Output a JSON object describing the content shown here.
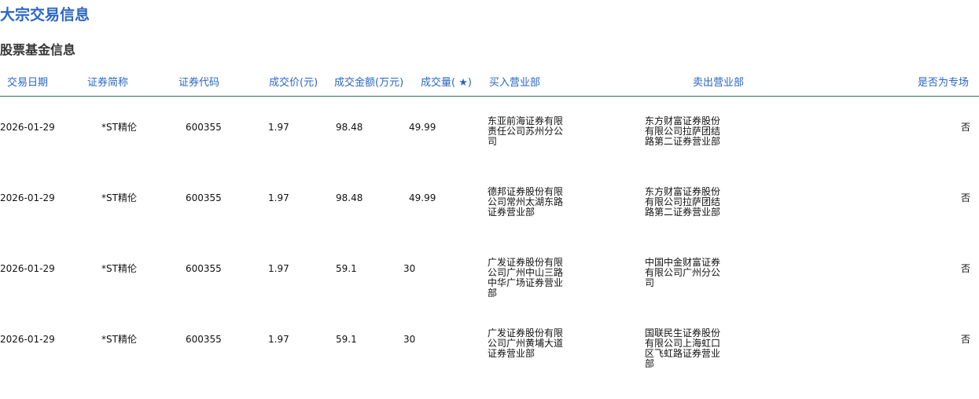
{
  "page": {
    "title": "大宗交易信息",
    "section_title": "股票基金信息"
  },
  "table": {
    "headers": [
      "交易日期",
      "证券简称",
      "证券代码",
      "成交价(元)",
      "成交金额(万元)",
      "成交量( ★)",
      "买入营业部",
      "卖出营业部",
      "是否为专场"
    ],
    "rows": [
      [
        "2026-01-29",
        "*ST精伦",
        "600355",
        "1.97",
        "98.48",
        "49.99",
        "东亚前海证券有限责任公司苏州分公司",
        "东方财富证券股份有限公司拉萨团结路第二证券营业部",
        "否"
      ],
      [
        "2026-01-29",
        "*ST精伦",
        "600355",
        "1.97",
        "98.48",
        "49.99",
        "德邦证券股份有限公司常州太湖东路证券营业部",
        "东方财富证券股份有限公司拉萨团结路第二证券营业部",
        "否"
      ],
      [
        "2026-01-29",
        "*ST精伦",
        "600355",
        "1.97",
        "59.1",
        "30",
        "广发证券股份有限公司广州中山三路中华广场证券营业部",
        "中国中金财富证券有限公司广州分公司",
        "否"
      ],
      [
        "2026-01-29",
        "*ST精伦",
        "600355",
        "1.97",
        "59.1",
        "30",
        "广发证券股份有限公司广州黄埔大道证券营业部",
        "国联民生证券股份有限公司上海虹口区飞虹路证券营业部",
        "否"
      ]
    ]
  },
  "colors": {
    "title": "#2a66c4",
    "header_text": "#2a66c4",
    "header_rule": "#2f6e4c",
    "body_text": "#111111"
  }
}
